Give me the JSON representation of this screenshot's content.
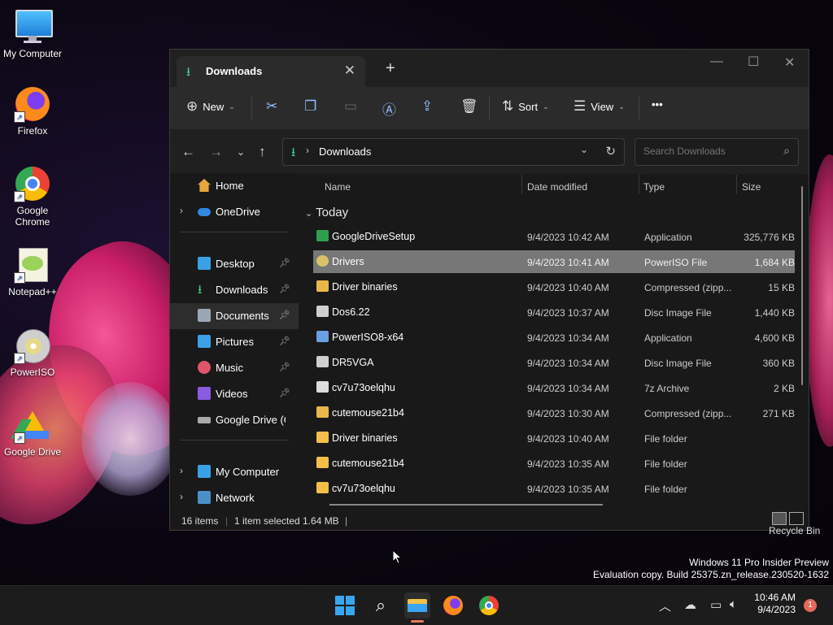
{
  "desktop": {
    "icons": [
      {
        "label": "My Computer"
      },
      {
        "label": "Firefox"
      },
      {
        "label": "Google Chrome"
      },
      {
        "label": "Notepad++"
      },
      {
        "label": "PowerISO"
      },
      {
        "label": "Google Drive"
      }
    ],
    "recycle_bin": "Recycle Bin",
    "watermark_line1": "Windows 11 Pro Insider Preview",
    "watermark_line2": "Evaluation copy. Build 25375.zn_release.230520-1632"
  },
  "window": {
    "tab_title": "Downloads",
    "new_tab": "+",
    "toolbar": {
      "new_label": "New",
      "sort_label": "Sort",
      "view_label": "View",
      "more_label": "•••"
    },
    "address": {
      "breadcrumb": "Downloads",
      "search_placeholder": "Search Downloads"
    },
    "nav": {
      "items": [
        {
          "label": "Home"
        },
        {
          "label": "OneDrive"
        },
        {
          "label": "Desktop"
        },
        {
          "label": "Downloads"
        },
        {
          "label": "Documents"
        },
        {
          "label": "Pictures"
        },
        {
          "label": "Music"
        },
        {
          "label": "Videos"
        },
        {
          "label": "Google Drive (G:)"
        },
        {
          "label": "My Computer"
        },
        {
          "label": "Network"
        }
      ]
    },
    "columns": {
      "name": "Name",
      "date": "Date modified",
      "type": "Type",
      "size": "Size"
    },
    "group": "Today",
    "files": [
      {
        "name": "GoogleDriveSetup",
        "date": "9/4/2023 10:42 AM",
        "type": "Application",
        "size": "325,776 KB",
        "icon_color": "#2f9e4f"
      },
      {
        "name": "Drivers",
        "date": "9/4/2023 10:41 AM",
        "type": "PowerISO File",
        "size": "1,684 KB",
        "icon_color": "#d9c36a"
      },
      {
        "name": "Driver binaries",
        "date": "9/4/2023 10:40 AM",
        "type": "Compressed (zipp...",
        "size": "15 KB",
        "icon_color": "#e8b84a"
      },
      {
        "name": "Dos6.22",
        "date": "9/4/2023 10:37 AM",
        "type": "Disc Image File",
        "size": "1,440 KB",
        "icon_color": "#cfcfcf"
      },
      {
        "name": "PowerISO8-x64",
        "date": "9/4/2023 10:34 AM",
        "type": "Application",
        "size": "4,600 KB",
        "icon_color": "#6aa0e0"
      },
      {
        "name": "DR5VGA",
        "date": "9/4/2023 10:34 AM",
        "type": "Disc Image File",
        "size": "360 KB",
        "icon_color": "#cfcfcf"
      },
      {
        "name": "cv7u73oelqhu",
        "date": "9/4/2023 10:34 AM",
        "type": "7z Archive",
        "size": "2 KB",
        "icon_color": "#dddddd"
      },
      {
        "name": "cutemouse21b4",
        "date": "9/4/2023 10:30 AM",
        "type": "Compressed (zipp...",
        "size": "271 KB",
        "icon_color": "#e8b84a"
      },
      {
        "name": "Driver binaries",
        "date": "9/4/2023 10:40 AM",
        "type": "File folder",
        "size": "",
        "icon_color": "#f2c04a"
      },
      {
        "name": "cutemouse21b4",
        "date": "9/4/2023 10:35 AM",
        "type": "File folder",
        "size": "",
        "icon_color": "#f2c04a"
      },
      {
        "name": "cv7u73oelqhu",
        "date": "9/4/2023 10:35 AM",
        "type": "File folder",
        "size": "",
        "icon_color": "#f2c04a"
      }
    ],
    "status": {
      "items": "16 items",
      "selected": "1 item selected",
      "size": "1.64 MB"
    }
  },
  "taskbar": {
    "time": "10:46 AM",
    "date": "9/4/2023",
    "notification_count": "1"
  }
}
